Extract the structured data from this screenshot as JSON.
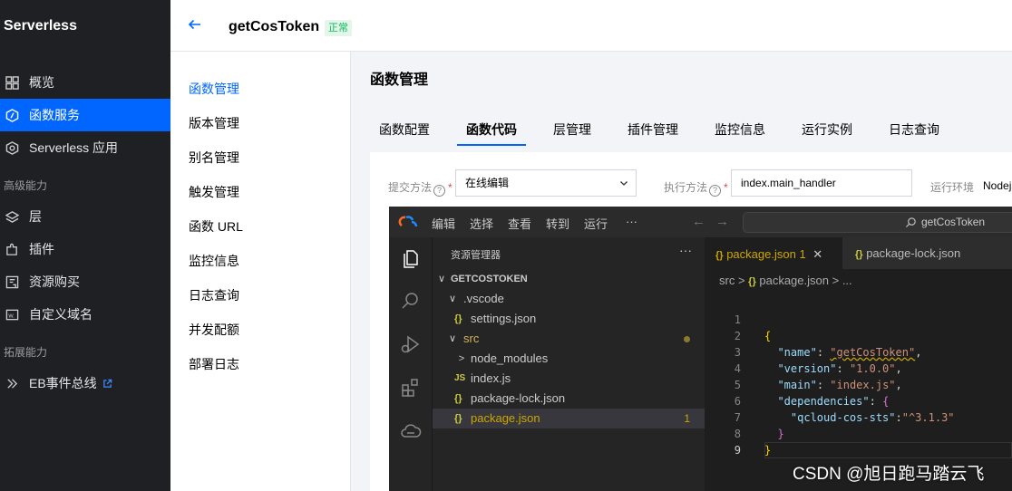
{
  "sidebar": {
    "brand": "Serverless",
    "items": [
      {
        "label": "概览",
        "icon": "grid-icon",
        "active": false
      },
      {
        "label": "函数服务",
        "icon": "function-icon",
        "active": true
      },
      {
        "label": "Serverless 应用",
        "icon": "app-icon",
        "active": false
      }
    ],
    "group_advanced": "高级能力",
    "advanced_items": [
      {
        "label": "层",
        "icon": "layers-icon"
      },
      {
        "label": "插件",
        "icon": "plugin-icon"
      },
      {
        "label": "资源购买",
        "icon": "cart-icon"
      },
      {
        "label": "自定义域名",
        "icon": "domain-icon"
      }
    ],
    "group_ext": "拓展能力",
    "ext_items": [
      {
        "label": "EB事件总线",
        "icon": "eventbus-icon",
        "external": true
      }
    ]
  },
  "header": {
    "function_name": "getCosToken",
    "status": "正常"
  },
  "subnav": {
    "items": [
      "函数管理",
      "版本管理",
      "别名管理",
      "触发管理",
      "函数 URL",
      "监控信息",
      "日志查询",
      "并发配额",
      "部署日志"
    ],
    "active": "函数管理"
  },
  "main": {
    "title": "函数管理",
    "tabs": [
      "函数配置",
      "函数代码",
      "层管理",
      "插件管理",
      "监控信息",
      "运行实例",
      "日志查询"
    ],
    "active_tab": "函数代码"
  },
  "form": {
    "submit_label": "提交方法",
    "submit_value": "在线编辑",
    "handler_label": "执行方法",
    "handler_value": "index.main_handler",
    "runtime_label": "运行环境",
    "runtime_value": "Nodejs"
  },
  "editor": {
    "menu": [
      "编辑",
      "选择",
      "查看",
      "转到",
      "运行",
      "···"
    ],
    "search": "getCosToken",
    "explorer_title": "资源管理器",
    "root": "GETCOSTOKEN",
    "tree": {
      "vscode": ".vscode",
      "settings": "settings.json",
      "src": "src",
      "node_modules": "node_modules",
      "index": "index.js",
      "lock": "package-lock.json",
      "package": "package.json",
      "package_badge": "1"
    },
    "tabs": {
      "active": "package.json",
      "active_badge": "1",
      "inactive": "package-lock.json"
    },
    "breadcrumb": {
      "folder": "src",
      "file": "package.json",
      "rest": "..."
    },
    "code": {
      "name_key": "\"name\"",
      "name_val": "\"getCosToken\"",
      "version_key": "\"version\"",
      "version_val": "\"1.0.0\"",
      "main_key": "\"main\"",
      "main_val": "\"index.js\"",
      "deps_key": "\"dependencies\"",
      "dep_key": "\"qcloud-cos-sts\"",
      "dep_val": "\"^3.1.3\""
    },
    "line_numbers": [
      "1",
      "2",
      "3",
      "4",
      "5",
      "6",
      "7",
      "8",
      "9"
    ]
  },
  "watermark": "CSDN @旭日跑马踏云飞",
  "colors": {
    "sidebar_bg": "#1f2024",
    "accent": "#0066ff",
    "status_green": "#0abf5b",
    "editor_bg": "#1e1e1e"
  }
}
